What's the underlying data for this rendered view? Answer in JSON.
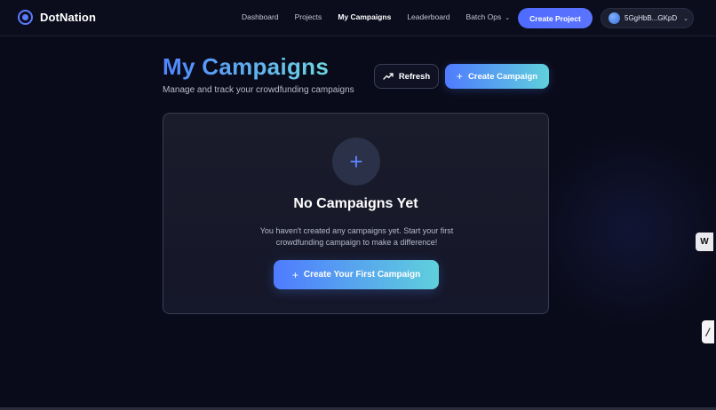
{
  "brand": {
    "name": "DotNation"
  },
  "nav": {
    "links": [
      "Dashboard",
      "Projects",
      "My Campaigns",
      "Leaderboard",
      "Batch Ops"
    ],
    "active": "My Campaigns",
    "create_project_label": "Create Project",
    "wallet_address": "5GgHbB...GKpD"
  },
  "header": {
    "title": "My Campaigns",
    "subtitle": "Manage and track your crowdfunding campaigns",
    "refresh_label": "Refresh",
    "create_campaign_label": "Create Campaign"
  },
  "empty_state": {
    "title": "No Campaigns Yet",
    "description": "You haven't created any campaigns yet. Start your first crowdfunding campaign to make a difference!",
    "button_label": "Create Your First Campaign"
  },
  "side_widget": {
    "label": "W"
  },
  "colors": {
    "background": "#0a0b1a",
    "accent": "#4f6bff",
    "gradient_start": "#4f7bff",
    "gradient_end": "#5fd0dc"
  }
}
